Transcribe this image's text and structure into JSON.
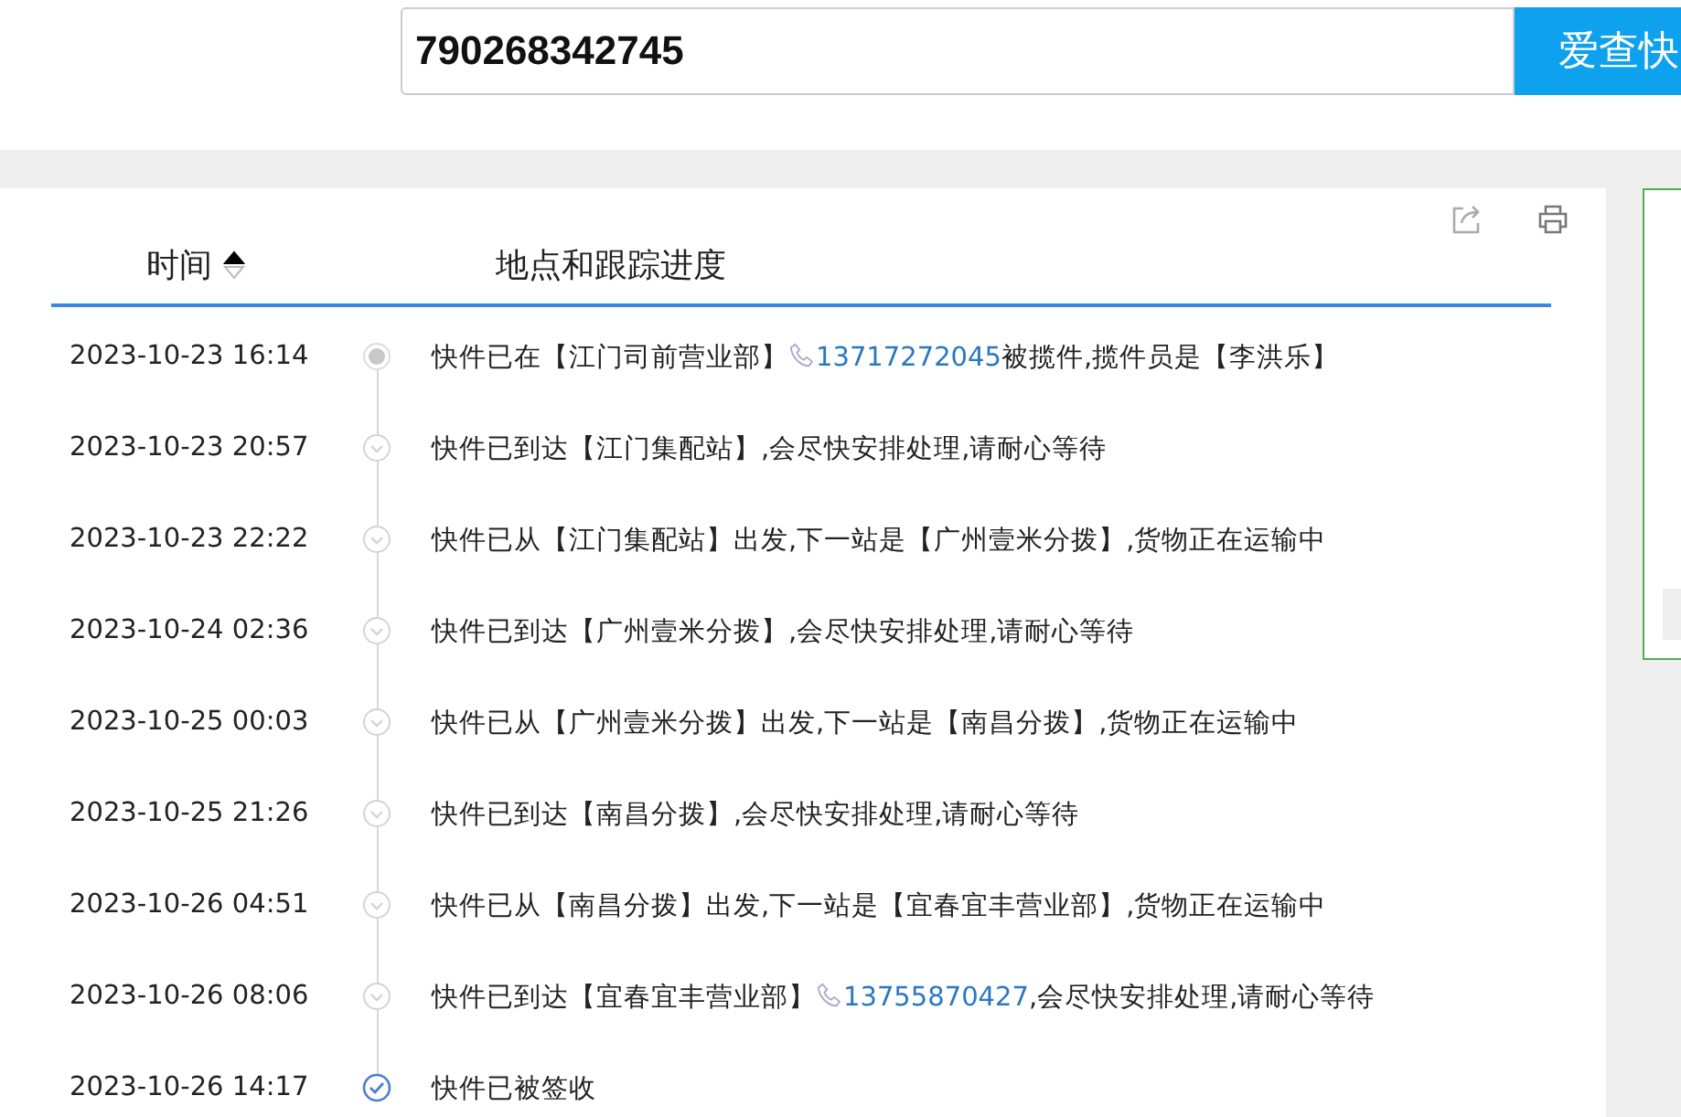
{
  "search": {
    "value": "790268342745",
    "button": "爱查快"
  },
  "table": {
    "columns": [
      {
        "label": "时间",
        "sorted": true
      },
      {
        "label": "地点和跟踪进度"
      }
    ],
    "rows": [
      {
        "time": "2023-10-23 16:14",
        "kind": "collected",
        "text": "快件已在【江门司前营业部】",
        "phone": "13717272045",
        "text_after": "被揽件,揽件员是【李洪乐】"
      },
      {
        "time": "2023-10-23 20:57",
        "kind": "transit",
        "text": "快件已到达【江门集配站】,会尽快安排处理,请耐心等待"
      },
      {
        "time": "2023-10-23 22:22",
        "kind": "transit",
        "text": "快件已从【江门集配站】出发,下一站是【广州壹米分拨】,货物正在运输中"
      },
      {
        "time": "2023-10-24 02:36",
        "kind": "transit",
        "text": "快件已到达【广州壹米分拨】,会尽快安排处理,请耐心等待"
      },
      {
        "time": "2023-10-25 00:03",
        "kind": "transit",
        "text": "快件已从【广州壹米分拨】出发,下一站是【南昌分拨】,货物正在运输中"
      },
      {
        "time": "2023-10-25 21:26",
        "kind": "transit",
        "text": "快件已到达【南昌分拨】,会尽快安排处理,请耐心等待"
      },
      {
        "time": "2023-10-26 04:51",
        "kind": "transit",
        "text": "快件已从【南昌分拨】出发,下一站是【宜春宜丰营业部】,货物正在运输中"
      },
      {
        "time": "2023-10-26 08:06",
        "kind": "transit",
        "text": "快件已到达【宜春宜丰营业部】",
        "phone": "13755870427",
        "text_after": ",会尽快安排处理,请耐心等待"
      },
      {
        "time": "2023-10-26 14:17",
        "kind": "signed",
        "text": "快件已被签收"
      }
    ]
  }
}
